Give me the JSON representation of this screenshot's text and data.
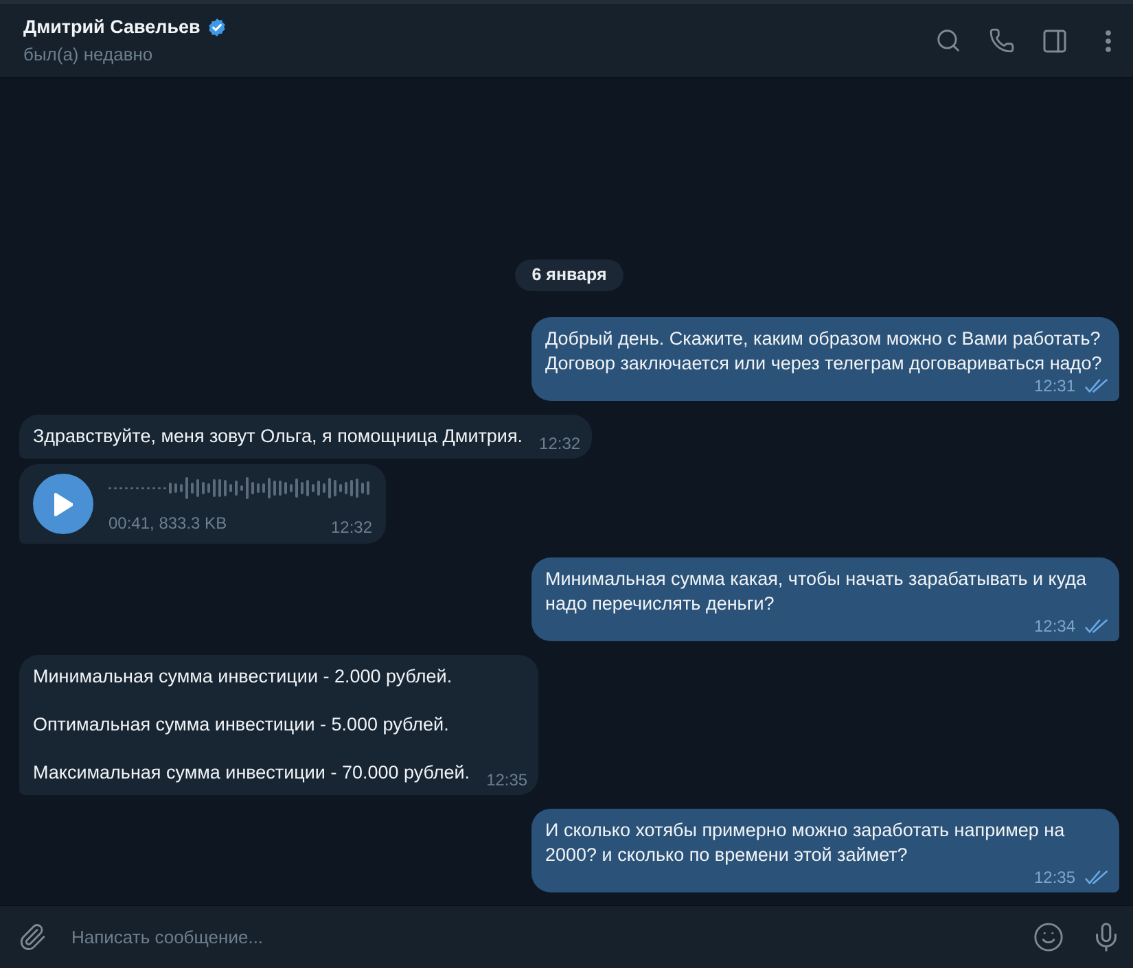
{
  "header": {
    "name": "Дмитрий Савельев",
    "verified": true,
    "status": "был(а) недавно"
  },
  "date_divider": "6 января",
  "messages": [
    {
      "kind": "text",
      "outgoing": true,
      "paragraphs": [
        "Добрый день. Скажите, каким образом можно с Вами работать? Договор заключается или через телеграм договариваться надо?"
      ],
      "time": "12:31",
      "read": true
    },
    {
      "kind": "text",
      "outgoing": false,
      "paragraphs": [
        "Здравствуйте, меня зовут Ольга, я помощница Дмитрия."
      ],
      "time": "12:32"
    },
    {
      "kind": "voice",
      "outgoing": false,
      "info": "00:41, 833.3 KB",
      "time": "12:32"
    },
    {
      "kind": "text",
      "outgoing": true,
      "paragraphs": [
        "Минимальная сумма какая, чтобы начать зарабатывать и куда надо перечислять деньги?"
      ],
      "time": "12:34",
      "read": true
    },
    {
      "kind": "text",
      "outgoing": false,
      "paragraphs": [
        "Минимальная сумма инвестиции - 2.000 рублей.",
        "Оптимальная сумма инвестиции - 5.000 рублей.",
        "Максимальная сумма инвестиции - 70.000 рублей."
      ],
      "time": "12:35"
    },
    {
      "kind": "text",
      "outgoing": true,
      "paragraphs": [
        "И сколько хотябы примерно можно заработать например на 2000? и сколько по времени этой займет?"
      ],
      "time": "12:35",
      "read": true
    }
  ],
  "composer": {
    "placeholder": "Написать сообщение..."
  }
}
